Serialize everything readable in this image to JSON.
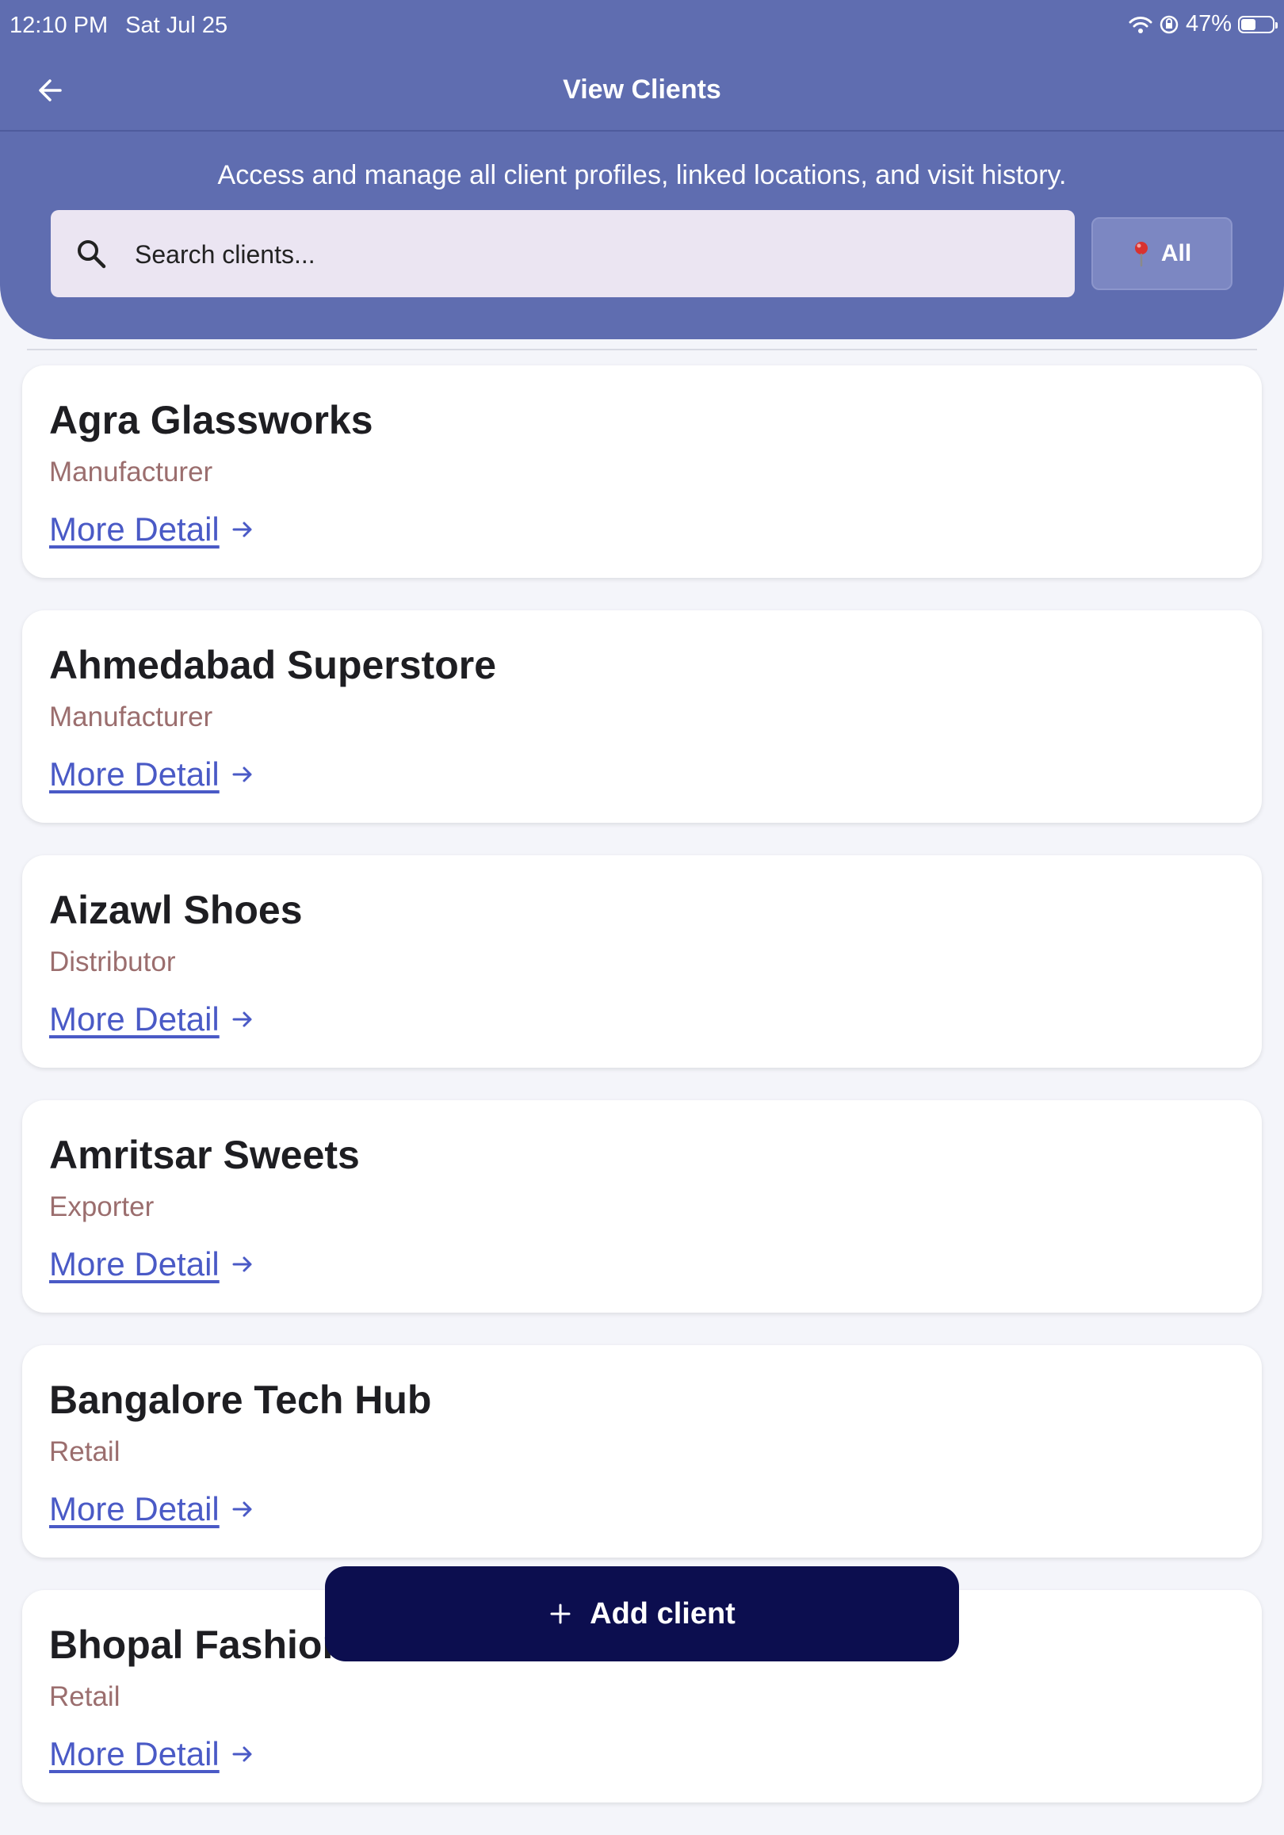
{
  "status_bar": {
    "time": "12:10 PM",
    "date": "Sat Jul 25",
    "battery": "47%",
    "battery_level": 0.47,
    "icons": [
      "wifi-icon",
      "orientation-lock-icon",
      "battery-icon"
    ]
  },
  "header": {
    "title": "View Clients",
    "back_icon": "arrow-left-icon",
    "subtitle": "Access and manage all client profiles, linked locations, and visit history."
  },
  "search": {
    "placeholder": "Search clients...",
    "value": "",
    "icon": "search-icon"
  },
  "filter": {
    "icon": "pin-icon",
    "label": "All"
  },
  "clients": [
    {
      "name": "Agra Glassworks",
      "type": "Manufacturer",
      "link": "More Detail"
    },
    {
      "name": "Ahmedabad Superstore",
      "type": "Manufacturer",
      "link": "More Detail"
    },
    {
      "name": "Aizawl Shoes",
      "type": "Distributor",
      "link": "More Detail"
    },
    {
      "name": "Amritsar Sweets",
      "type": "Exporter",
      "link": "More Detail"
    },
    {
      "name": "Bangalore Tech Hub",
      "type": "Retail",
      "link": "More Detail"
    },
    {
      "name": "Bhopal Fashion",
      "type": "Retail",
      "link": "More Detail"
    }
  ],
  "add_button": {
    "label": "Add client",
    "icon": "plus-icon"
  },
  "colors": {
    "header": "#5f6db0",
    "link": "#4a5ac6",
    "client_type": "#9b6e6e",
    "fab": "#0c0e4f"
  }
}
